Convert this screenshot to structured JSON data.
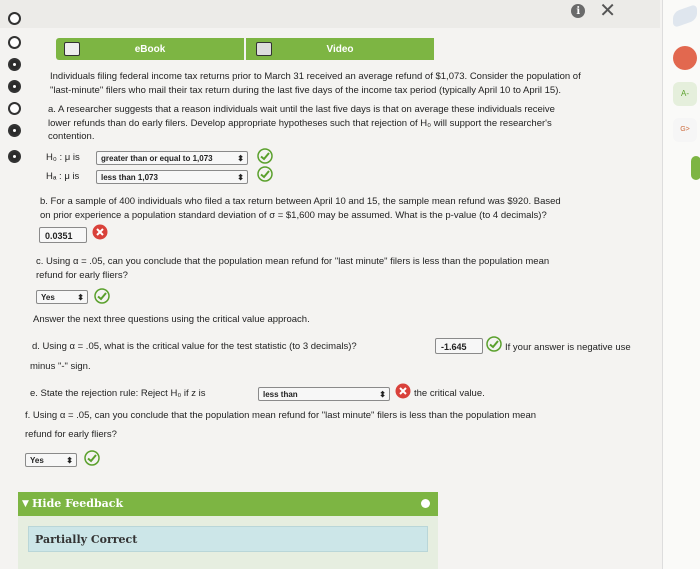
{
  "tabs": {
    "ebook": "eBook",
    "video": "Video"
  },
  "intro": [
    "Individuals filing federal income tax returns prior to March 31 received an average refund of $1,073. Consider the population of",
    "\"last-minute\" filers who mail their tax return during the last five days of the income tax period (typically April 10 to April 15)."
  ],
  "part_a": [
    "a. A researcher suggests that a reason individuals wait until the last five days is that on average these individuals receive",
    "lower refunds than do early filers. Develop appropriate hypotheses such that rejection of H₀ will support the researcher's",
    "contention."
  ],
  "h0": {
    "label": "H₀ : μ is",
    "selected": "greater than or equal to 1,073"
  },
  "ha": {
    "label": "Hₐ : μ is",
    "selected": "less than 1,073"
  },
  "part_b": [
    "b. For a sample of 400 individuals who filed a tax return between April 10 and 15, the sample mean refund was $920. Based",
    "on prior experience a population standard deviation of σ = $1,600 may be assumed. What is the p-value (to 4 decimals)?"
  ],
  "p_value": "0.0351",
  "part_c": [
    "c. Using α = .05, can you conclude that the population mean refund for \"last minute\" filers is less than the population mean",
    "refund for early fliers?"
  ],
  "c_answer": "Yes",
  "critical_intro": "Answer the next three questions using the critical value approach.",
  "part_d": {
    "q": "d. Using α = .05, what is the critical value for the test statistic (to 3 decimals)?",
    "answer": "-1.645",
    "note": "If your answer is negative use",
    "note2": "minus \"-\" sign."
  },
  "part_e": {
    "q": "e. State the rejection rule: Reject H₀ if z is",
    "selected": "less than",
    "tail": "the critical value."
  },
  "part_f": [
    "f. Using α = .05, can you conclude that the population mean refund for \"last minute\" filers is less than the population mean",
    "refund for early fliers?"
  ],
  "f_answer": "Yes",
  "feedback": {
    "toggle": "Hide Feedback",
    "status": "Partially Correct"
  },
  "right_strip": {
    "label1": "A-",
    "label2": "G>"
  },
  "colors": {
    "accent": "#7db543",
    "correct": "#5aa02c",
    "incorrect": "#d9413a",
    "feedback_panel": "#cce6e8"
  }
}
